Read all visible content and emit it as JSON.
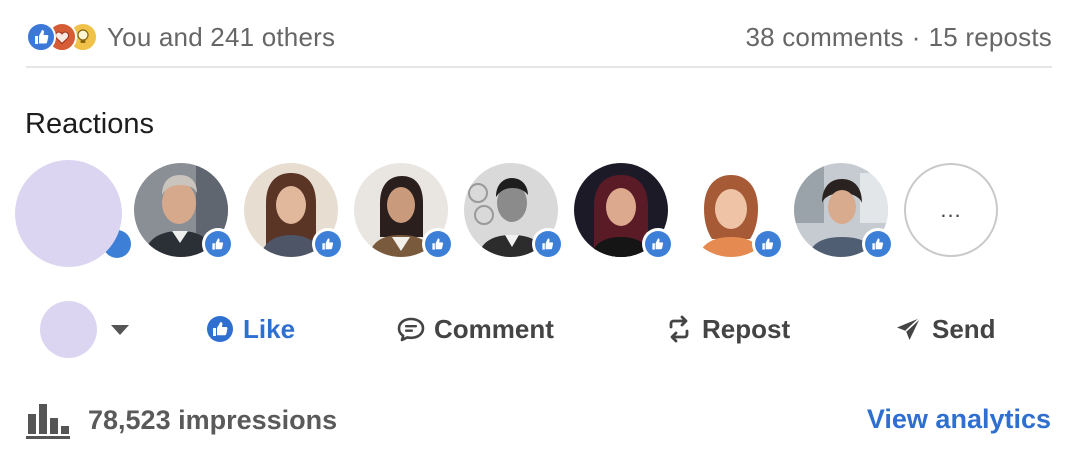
{
  "social_counts": {
    "reaction_icons": [
      "like-icon",
      "love-icon",
      "insightful-icon"
    ],
    "reactors_text": "You and 241 others",
    "comments": "38 comments",
    "separator": "·",
    "reposts": "15 reposts"
  },
  "reactions": {
    "title": "Reactions",
    "reactors": [
      {
        "avatar": "avatar-man-gray-hair",
        "reaction": "like-icon"
      },
      {
        "avatar": "avatar-woman-long-brown-hair",
        "reaction": "like-icon"
      },
      {
        "avatar": "avatar-woman-dark-hair",
        "reaction": "like-icon"
      },
      {
        "avatar": "avatar-man-black-white-photo",
        "reaction": "like-icon"
      },
      {
        "avatar": "avatar-woman-dark-background",
        "reaction": "like-icon"
      },
      {
        "avatar": "avatar-woman-auburn-hair",
        "reaction": "like-icon"
      },
      {
        "avatar": "avatar-woman-short-dark-hair",
        "reaction": "like-icon"
      }
    ],
    "more_label": "..."
  },
  "actions": {
    "like": "Like",
    "comment": "Comment",
    "repost": "Repost",
    "send": "Send"
  },
  "analytics": {
    "impressions": "78,523 impressions",
    "view_link": "View analytics"
  },
  "colors": {
    "accent": "#2e6fd0",
    "like_badge": "#3d7fd6",
    "placeholder_avatar": "#dcd5f1",
    "muted_text": "#666666"
  }
}
